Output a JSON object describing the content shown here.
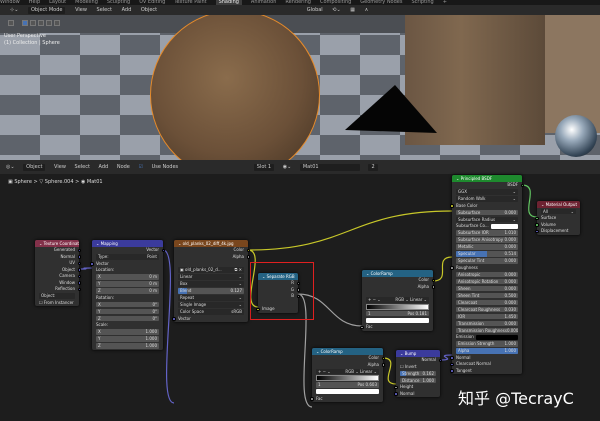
{
  "workspace_tabs": [
    "Window",
    "Help",
    "Layout",
    "Modeling",
    "Sculpting",
    "UV Editing",
    "Texture Paint",
    "Shading",
    "Animation",
    "Rendering",
    "Compositing",
    "Geometry Nodes",
    "Scripting",
    "+"
  ],
  "active_tab": "Shading",
  "viewport_header": {
    "mode": "Object Mode",
    "menus": [
      "View",
      "Select",
      "Add",
      "Object"
    ],
    "orientation": "Global"
  },
  "viewport_overlay": {
    "line1": "User Perspective",
    "line2": "(1) Collection | Sphere"
  },
  "node_header": {
    "type": "Object",
    "menus": [
      "View",
      "Select",
      "Add",
      "Node"
    ],
    "use_nodes": "Use Nodes",
    "slot": "Slot 1",
    "material": "Mat01",
    "users": "2"
  },
  "breadcrumb": {
    "a": "Sphere",
    "b": "Sphere.004",
    "c": "Mat01",
    "sep": ">"
  },
  "colors": {
    "input": "#83314a",
    "vector": "#3b3b9c",
    "texture": "#79461d",
    "converter": "#246283",
    "shader": "#1e8a2e",
    "output": "#6d2231",
    "socket_color": "#c7c729",
    "socket_gray": "#a1a1a1",
    "socket_vec": "#6363c7",
    "socket_shader": "#63c763"
  },
  "nodes": [
    {
      "id": "texture-coordinate",
      "title": "Texture Coordinate",
      "head": "input",
      "rows": [
        {
          "t": "out",
          "l": "Generated",
          "s": "vec"
        },
        {
          "t": "out",
          "l": "Normal",
          "s": "vec"
        },
        {
          "t": "out",
          "l": "UV",
          "s": "vec"
        },
        {
          "t": "out",
          "l": "Object",
          "s": "vec"
        },
        {
          "t": "out",
          "l": "Camera",
          "s": "vec"
        },
        {
          "t": "out",
          "l": "Window",
          "s": "vec"
        },
        {
          "t": "out",
          "l": "Reflection",
          "s": "vec"
        },
        {
          "t": "dd",
          "l": "Object:",
          "v": ""
        },
        {
          "t": "text",
          "l": "☐ From Instancer"
        }
      ]
    },
    {
      "id": "mapping",
      "title": "Mapping",
      "head": "vector",
      "rows": [
        {
          "t": "out",
          "l": "Vector",
          "s": "vec"
        },
        {
          "t": "dd",
          "l": "Type:",
          "v": "Point"
        },
        {
          "t": "in",
          "l": "Vector",
          "s": "vec"
        },
        {
          "t": "text",
          "l": "Location:"
        },
        {
          "t": "field",
          "l": "X",
          "v": "0 m"
        },
        {
          "t": "field",
          "l": "Y",
          "v": "0 m"
        },
        {
          "t": "field",
          "l": "Z",
          "v": "0 m"
        },
        {
          "t": "text",
          "l": "Rotation:"
        },
        {
          "t": "field",
          "l": "X",
          "v": "0°"
        },
        {
          "t": "field",
          "l": "Y",
          "v": "0°"
        },
        {
          "t": "field",
          "l": "Z",
          "v": "0°"
        },
        {
          "t": "text",
          "l": "Scale:"
        },
        {
          "t": "field",
          "l": "X",
          "v": "1.000"
        },
        {
          "t": "field",
          "l": "Y",
          "v": "1.000"
        },
        {
          "t": "field",
          "l": "Z",
          "v": "1.000"
        }
      ]
    },
    {
      "id": "image-texture",
      "title": "old_planks_02_diff_4k.jpg",
      "head": "texture",
      "rows": [
        {
          "t": "out",
          "l": "Color",
          "s": "color"
        },
        {
          "t": "out",
          "l": "Alpha",
          "s": "gray"
        },
        {
          "t": "text",
          "l": ""
        },
        {
          "t": "dd",
          "l": "▣ old_planks_02_d...",
          "v": "⧉ ✕"
        },
        {
          "t": "dd",
          "l": "Linear",
          "v": "⌄"
        },
        {
          "t": "dd",
          "l": "Box",
          "v": "⌄"
        },
        {
          "t": "slider",
          "l": "Blend",
          "v": "0.127",
          "f": 0.13
        },
        {
          "t": "dd",
          "l": "Repeat",
          "v": "⌄"
        },
        {
          "t": "dd",
          "l": "Single Image",
          "v": "⌄"
        },
        {
          "t": "dd",
          "l": "Color Space",
          "v": "sRGB"
        },
        {
          "t": "in",
          "l": "Vector",
          "s": "vec"
        }
      ]
    },
    {
      "id": "separate-rgb",
      "title": "Separate RGB",
      "head": "converter",
      "rows": [
        {
          "t": "out",
          "l": "R",
          "s": "gray"
        },
        {
          "t": "out",
          "l": "G",
          "s": "gray"
        },
        {
          "t": "out",
          "l": "B",
          "s": "gray"
        },
        {
          "t": "text",
          "l": ""
        },
        {
          "t": "in",
          "l": "Image",
          "s": "color"
        }
      ]
    },
    {
      "id": "color-ramp-1",
      "title": "ColorRamp",
      "head": "converter",
      "rows": [
        {
          "t": "out",
          "l": "Color",
          "s": "color"
        },
        {
          "t": "out",
          "l": "Alpha",
          "s": "gray"
        },
        {
          "t": "text",
          "l": ""
        },
        {
          "t": "dd",
          "l": "+  −  ⌄",
          "v": "RGB ⌄  Linear ⌄"
        },
        {
          "t": "ramp"
        },
        {
          "t": "field",
          "l": "1",
          "v": "Pos 0.181"
        },
        {
          "t": "swatch",
          "c": "#ffffff"
        },
        {
          "t": "in",
          "l": "Fac",
          "s": "gray"
        }
      ]
    },
    {
      "id": "color-ramp-2",
      "title": "ColorRamp",
      "head": "converter",
      "rows": [
        {
          "t": "out",
          "l": "Color",
          "s": "color"
        },
        {
          "t": "out",
          "l": "Alpha",
          "s": "gray"
        },
        {
          "t": "dd",
          "l": "+  −  ⌄",
          "v": "RGB ⌄  Linear ⌄"
        },
        {
          "t": "ramp"
        },
        {
          "t": "field",
          "l": "1",
          "v": "Pos 0.603"
        },
        {
          "t": "swatch",
          "c": "#ffffff"
        },
        {
          "t": "in",
          "l": "Fac",
          "s": "gray"
        }
      ]
    },
    {
      "id": "bump",
      "title": "Bump",
      "head": "vector",
      "rows": [
        {
          "t": "out",
          "l": "Normal",
          "s": "vec"
        },
        {
          "t": "text",
          "l": "☐ Invert"
        },
        {
          "t": "slider",
          "l": "Strength",
          "v": "0.162",
          "f": 0.16
        },
        {
          "t": "field",
          "l": "Distance",
          "v": "1.000"
        },
        {
          "t": "in",
          "l": "Height",
          "s": "gray"
        },
        {
          "t": "in",
          "l": "Normal",
          "s": "vec"
        }
      ]
    },
    {
      "id": "principled-bsdf",
      "title": "Principled BSDF",
      "head": "shader",
      "rows": [
        {
          "t": "out",
          "l": "BSDF",
          "s": "shader"
        },
        {
          "t": "dd",
          "l": "GGX",
          "v": "⌄"
        },
        {
          "t": "dd",
          "l": "Random Walk",
          "v": "⌄"
        },
        {
          "t": "in",
          "l": "Base Color",
          "s": "color"
        },
        {
          "t": "field",
          "l": "Subsurface",
          "v": "0.000"
        },
        {
          "t": "dd",
          "l": "Subsurface Radius",
          "v": "⌄"
        },
        {
          "t": "swatch",
          "l": "Subsurface Co...",
          "c": "#ffffff"
        },
        {
          "t": "field",
          "l": "Subsurface IOR",
          "v": "1.010"
        },
        {
          "t": "field",
          "l": "Subsurface Anisotropy",
          "v": "0.000"
        },
        {
          "t": "field",
          "l": "Metallic",
          "v": "0.000"
        },
        {
          "t": "slider",
          "l": "Specular",
          "v": "0.514",
          "f": 0.5
        },
        {
          "t": "field",
          "l": "Specular Tint",
          "v": "0.000"
        },
        {
          "t": "in",
          "l": "Roughness",
          "s": "gray"
        },
        {
          "t": "field",
          "l": "Anisotropic",
          "v": "0.000"
        },
        {
          "t": "field",
          "l": "Anisotropic Rotation",
          "v": "0.000"
        },
        {
          "t": "field",
          "l": "Sheen",
          "v": "0.000"
        },
        {
          "t": "field",
          "l": "Sheen Tint",
          "v": "0.500"
        },
        {
          "t": "field",
          "l": "Clearcoat",
          "v": "0.000"
        },
        {
          "t": "field",
          "l": "Clearcoat Roughness",
          "v": "0.030"
        },
        {
          "t": "field",
          "l": "IOR",
          "v": "1.450"
        },
        {
          "t": "field",
          "l": "Transmission",
          "v": "0.000"
        },
        {
          "t": "field",
          "l": "Transmission Roughness",
          "v": "0.000"
        },
        {
          "t": "swatch",
          "l": "Emission",
          "c": "#000000"
        },
        {
          "t": "field",
          "l": "Emission Strength",
          "v": "1.000"
        },
        {
          "t": "slider",
          "l": "Alpha",
          "v": "1.000",
          "f": 1
        },
        {
          "t": "in",
          "l": "Normal",
          "s": "vec"
        },
        {
          "t": "in",
          "l": "Clearcoat Normal",
          "s": "vec"
        },
        {
          "t": "in",
          "l": "Tangent",
          "s": "vec"
        }
      ]
    },
    {
      "id": "material-output",
      "title": "Material Output",
      "head": "output",
      "rows": [
        {
          "t": "dd",
          "l": "All",
          "v": "⌄"
        },
        {
          "t": "in",
          "l": "Surface",
          "s": "shader"
        },
        {
          "t": "in",
          "l": "Volume",
          "s": "shader"
        },
        {
          "t": "in",
          "l": "Displacement",
          "s": "vec"
        }
      ]
    }
  ],
  "watermark": "知乎 @TecrayC"
}
